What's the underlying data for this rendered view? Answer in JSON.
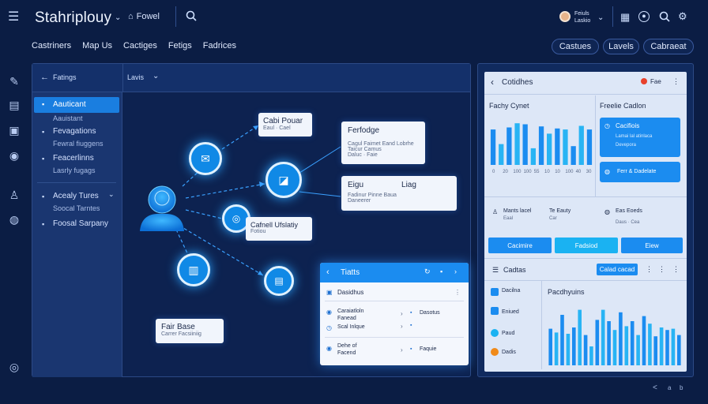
{
  "app": {
    "title": "Stahriplouy",
    "search_label": "Fowel"
  },
  "user": {
    "name": "Feiuls",
    "role": "Laskio"
  },
  "nav": {
    "tabs": [
      "Castriners",
      "Map Us",
      "Cactiges",
      "Fetigs",
      "Fadrices"
    ]
  },
  "header_actions": {
    "buttons": [
      "Castues",
      "Lavels",
      "Cabraeat"
    ]
  },
  "main": {
    "back_label": "Fatings",
    "view_label": "Lavis",
    "sidebar": {
      "active_item": "Aauticant",
      "active_sub": "Aauistant",
      "group1": {
        "title": "Fevagations",
        "sub": "Fewral fiuggens"
      },
      "group2": {
        "title": "Feacerlinns",
        "sub": "Lasrly fugags"
      },
      "group3": {
        "title": "Acealy Tures",
        "sub": "Soocal Tarntes"
      },
      "group4": {
        "title": "Foosal Sarpany"
      }
    },
    "cards": {
      "c1": {
        "title": "Cabi Pouar",
        "sub": "Eaul · Cael"
      },
      "c2": {
        "title": "Ferfodge",
        "l1": "Cagul Faimet Eand Lobrhe",
        "l2": "Taicur Camus",
        "l3": "Daluc · Faie"
      },
      "c3": {
        "title_a": "Eigu",
        "title_b": "Liag",
        "l1": "Fadinur Pinne Baua",
        "l2": "Daneerer"
      },
      "c4": {
        "title": "Cafnell Ufslatiy",
        "sub": "Fotiou"
      },
      "c5": {
        "title": "Fair Base",
        "sub": "Carrer Facsiiniig"
      }
    },
    "popup": {
      "title": "Tiatts",
      "header_item": "Dasidhus",
      "rows": [
        {
          "a": "Caraiatloln",
          "b": "Fanead",
          "c": "Dasotus"
        },
        {
          "a": "Scal Inlque",
          "b": "",
          "c": ""
        },
        {
          "a": "Dehe of",
          "b": "Facend",
          "c": "Faquie"
        }
      ]
    }
  },
  "right": {
    "title": "Cotidhes",
    "badge": "Fae",
    "chart1": {
      "title": "Fachy Cynet",
      "axis": [
        "0",
        "20",
        "100",
        "100",
        "55",
        "10",
        "10",
        "100",
        "40",
        "30"
      ]
    },
    "detail": {
      "title": "Freelie Cadlon",
      "btn1": {
        "title": "Cacifiois",
        "l1": "Lamai lal atinlaca",
        "l2": "Devepora"
      },
      "btn2": "Ferr & Dadelate"
    },
    "stats": [
      {
        "a": "Mants lacel",
        "b": "Eaal"
      },
      {
        "a": "Te Eauty",
        "b": "Car"
      },
      {
        "a": "Eas Eoeds",
        "b": "Daus · Cea"
      }
    ],
    "actions": [
      "Cacimire",
      "Fadsiod",
      "Eiew"
    ],
    "list": {
      "title": "Cadtas",
      "button": "Calad cacad",
      "items": [
        "Dacilna",
        "Eniued",
        "Paud",
        "Dadis"
      ]
    },
    "chart2": {
      "title": "Pacdhyuins"
    }
  },
  "chart_data": [
    {
      "type": "bar",
      "title": "Fachy Cynet",
      "values": [
        68,
        40,
        72,
        80,
        78,
        32,
        74,
        60,
        70,
        68,
        36,
        75,
        68
      ]
    },
    {
      "type": "bar",
      "title": "Pacdhyuins",
      "values": [
        58,
        52,
        80,
        50,
        60,
        88,
        48,
        30,
        72,
        88,
        70,
        56,
        84,
        62,
        70,
        48,
        78,
        66,
        46,
        60,
        56,
        58,
        48
      ]
    }
  ],
  "footer": {
    "pager": [
      "<",
      "a",
      "b"
    ]
  }
}
